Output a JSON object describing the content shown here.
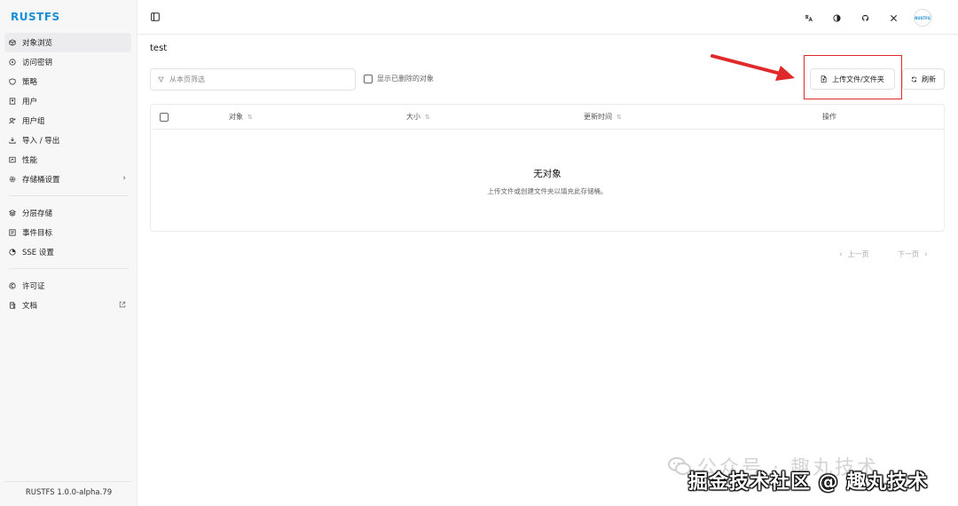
{
  "app": {
    "logo": "RUSTFS",
    "version": "RUSTFS 1.0.0-alpha.79"
  },
  "colors": {
    "brand": "#1a8fd6",
    "highlight": "#e02a2a"
  },
  "sidebar": {
    "items": [
      {
        "label": "对象浏览",
        "icon": "cube-icon",
        "active": true
      },
      {
        "label": "访问密钥",
        "icon": "key-icon"
      },
      {
        "label": "策略",
        "icon": "shield-icon"
      },
      {
        "label": "用户",
        "icon": "user-icon"
      },
      {
        "label": "用户组",
        "icon": "users-icon"
      },
      {
        "label": "导入 / 导出",
        "icon": "download-icon"
      },
      {
        "label": "性能",
        "icon": "chart-icon"
      },
      {
        "label": "存储桶设置",
        "icon": "gear-icon",
        "has_arrow": true
      },
      {
        "label": "分层存储",
        "icon": "layers-icon"
      },
      {
        "label": "事件目标",
        "icon": "target-icon"
      },
      {
        "label": "SSE 设置",
        "icon": "lock-icon"
      },
      {
        "label": "许可证",
        "icon": "copyright-icon"
      },
      {
        "label": "文档",
        "icon": "doc-icon",
        "external": true
      }
    ]
  },
  "topbar": {
    "icons": [
      "translate-icon",
      "theme-icon",
      "github-icon",
      "x-icon"
    ],
    "avatar_text": "RUSTFS"
  },
  "main": {
    "title": "test",
    "filter_placeholder": "从本页筛选",
    "show_deleted_label": "显示已删除的对象",
    "upload_label": "上传文件/文件夹",
    "refresh_label": "刷新"
  },
  "table": {
    "columns": [
      "对象",
      "大小",
      "更新时间",
      "操作"
    ],
    "empty_title": "无对象",
    "empty_desc": "上传文件或创建文件夹以填充此存储桶。"
  },
  "pagination": {
    "prev": "上一页",
    "next": "下一页"
  },
  "watermark": {
    "line1": "公众号 · 趣丸技术",
    "line2": "掘金技术社区 @ 趣丸技术"
  }
}
